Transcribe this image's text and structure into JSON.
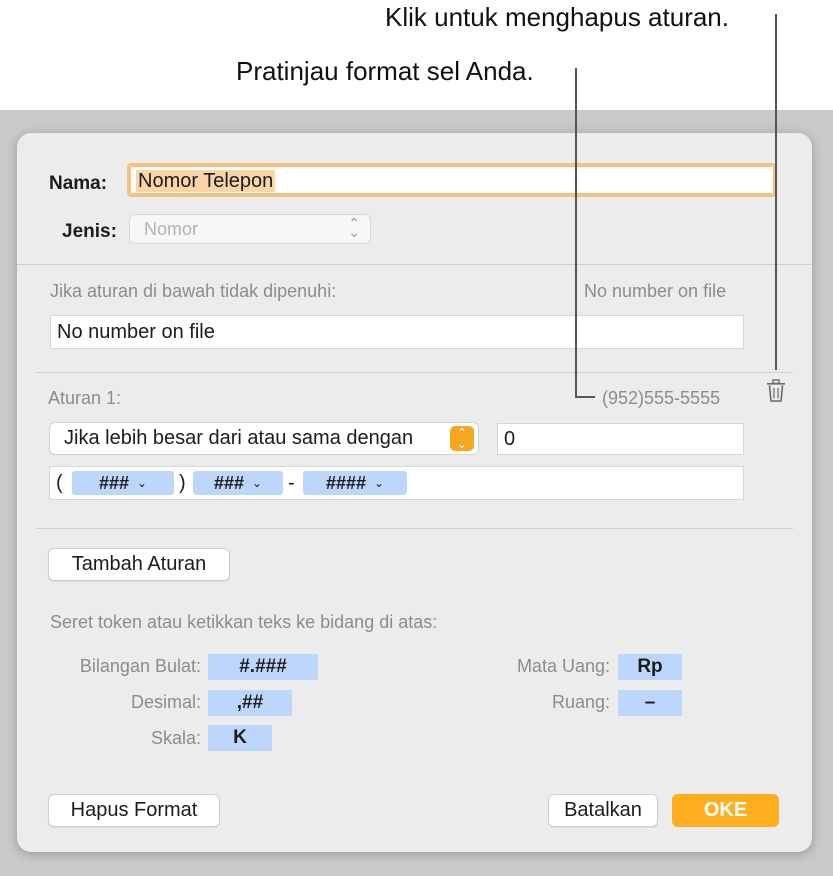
{
  "callouts": {
    "delete_rule": "Klik untuk menghapus aturan.",
    "preview": "Pratinjau format sel Anda."
  },
  "dialog": {
    "name_label": "Nama:",
    "name_value": "Nomor Telepon",
    "type_label": "Jenis:",
    "type_value": "Nomor",
    "fallback": {
      "label": "Jika aturan di bawah tidak dipenuhi:",
      "preview": "No number on file",
      "value": "No number on file"
    },
    "rule": {
      "label": "Aturan 1:",
      "preview": "(952)555-5555",
      "condition": "Jika lebih besar dari atau sama dengan",
      "threshold": "0",
      "format": {
        "open_paren": "(",
        "close_paren": ")",
        "dash": "-",
        "tokens": [
          "###",
          "###",
          "####"
        ]
      }
    },
    "add_rule_button": "Tambah Aturan",
    "tokens_hint": "Seret token atau ketikkan teks ke bidang di atas:",
    "tokens": {
      "integer_label": "Bilangan Bulat:",
      "integer_value": "#.###",
      "decimal_label": "Desimal:",
      "decimal_value": ",##",
      "scale_label": "Skala:",
      "scale_value": "K",
      "currency_label": "Mata Uang:",
      "currency_value": "Rp",
      "space_label": "Ruang:",
      "space_value": "–"
    },
    "clear_format_button": "Hapus Format",
    "cancel_button": "Batalkan",
    "ok_button": "OKE"
  },
  "colors": {
    "accent": "#ffae1f",
    "token": "#bcd7fb",
    "name_focus_ring": "#f6c27d",
    "stepper": "#f5a623"
  },
  "icons": [
    "chevron-up-down-icon",
    "trash-icon",
    "chevron-down-icon"
  ]
}
